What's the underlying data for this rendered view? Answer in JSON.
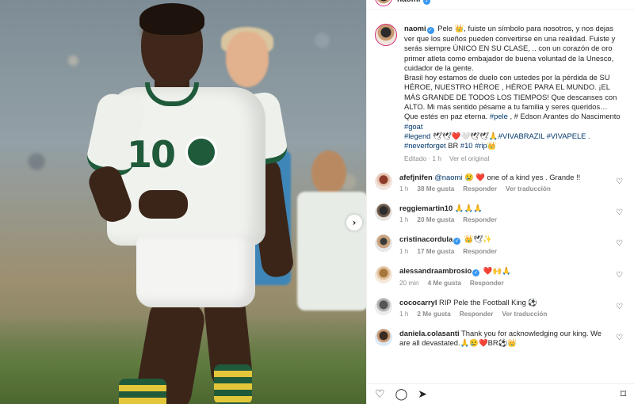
{
  "photo": {
    "jersey_number": "10",
    "next_label": "›"
  },
  "header": {
    "username": "naomi",
    "verified_glyph": "✓"
  },
  "caption": {
    "username": "naomi",
    "text_1": "Pele 👑, fuiste un símbolo para nosotros, y nos dejas ver que los sueños pueden convertirse en una realidad. Fuiste y serás siempre ÚNICO EN SU CLASE, .. con un corazón de oro primer atleta como embajador de buena voluntad de la Unesco, cuidador de la gente.",
    "text_2": "Brasil hoy estamos de duelo con ustedes por la pérdida de SU HÉROE, NUESTRO HÉROE , HÉROE PARA EL MUNDO. ¡EL MÁS GRANDE DE TODOS LOS TIEMPOS! Que descanses con ALTO. Mi más sentido pésame a tu familia y seres queridos… Que estés en paz eterna. ",
    "tag_pele": "#pele",
    "text_3": " , # Edson Arantes do Nascimento ",
    "tag_goat": "#goat",
    "tag_legend": "#legend",
    "text_4": " 🕊🕊❤️🤍🕊🕊🙏",
    "tag_vivabrazil": "#VIVABRAZIL",
    "tag_vivapele": "#VIVAPELE",
    "text_5": " .",
    "tag_neverforget": "#neverforget",
    "text_6": " BR ",
    "tag_10": "#10",
    "tag_rip": "#rip",
    "text_7": "👑",
    "edited": "Editado · 1 h",
    "see_original": "Ver el original"
  },
  "comments": [
    {
      "username": "afefjnifen",
      "verified": false,
      "mention": "@naomi",
      "text": " 😢 ❤️ one of a kind yes . Grande !!",
      "time": "1 h",
      "likes": "38 Me gusta",
      "reply": "Responder",
      "translate": "Ver traducción"
    },
    {
      "username": "reggiemartin10",
      "verified": false,
      "mention": "",
      "text": " 🙏🙏🙏",
      "time": "1 h",
      "likes": "20 Me gusta",
      "reply": "Responder",
      "translate": ""
    },
    {
      "username": "cristinacordula",
      "verified": true,
      "mention": "",
      "text": " 👑🕊✨",
      "time": "1 h",
      "likes": "17 Me gusta",
      "reply": "Responder",
      "translate": ""
    },
    {
      "username": "alessandraambrosio",
      "verified": true,
      "mention": "",
      "text": " ❤️🙌🙏",
      "time": "20 min",
      "likes": "4 Me gusta",
      "reply": "Responder",
      "translate": ""
    },
    {
      "username": "cococarryl",
      "verified": false,
      "mention": "",
      "text": " RIP Pele the Football King ⚽",
      "time": "1 h",
      "likes": "2 Me gusta",
      "reply": "Responder",
      "translate": "Ver traducción"
    },
    {
      "username": "daniela.colasanti",
      "verified": false,
      "mention": "",
      "text": " Thank you for acknowledging our king. We are all devastated.🙏😢❤️BR⚽👑",
      "time": "",
      "likes": "",
      "reply": "",
      "translate": ""
    }
  ],
  "icons": {
    "heart": "♡",
    "like": "♡",
    "comment": "◯",
    "share": "➤",
    "save": "⌑"
  },
  "colors": {
    "link": "#00376b",
    "verified": "#3897f0",
    "muted": "#8e8e8e",
    "jersey_green": "#1f5a3a"
  }
}
